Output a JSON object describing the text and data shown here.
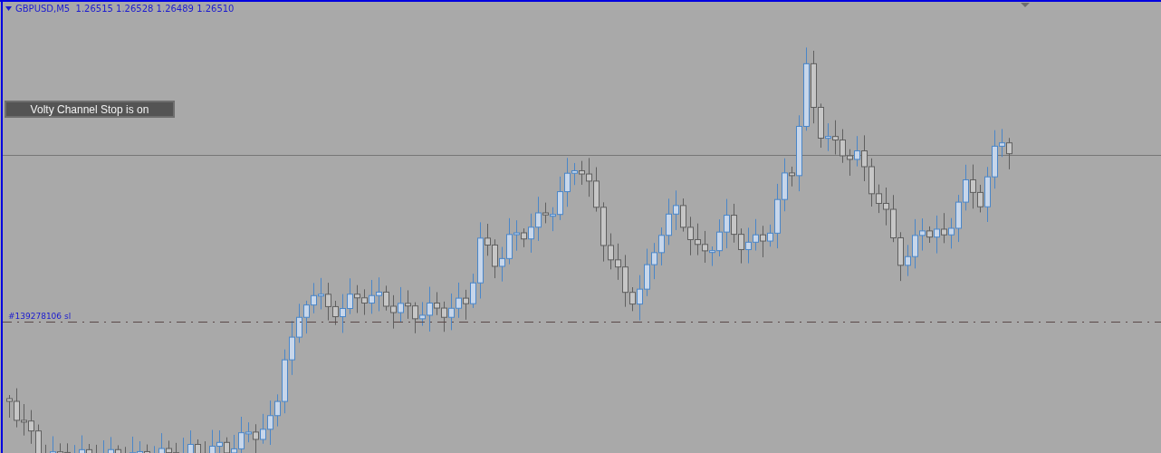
{
  "chart": {
    "header": "GBPUSD,M5  1.26515 1.26528 1.26489 1.26510",
    "indicator_status": "Volty Channel Stop is on",
    "order_line_label": "#139278106 sl"
  }
}
